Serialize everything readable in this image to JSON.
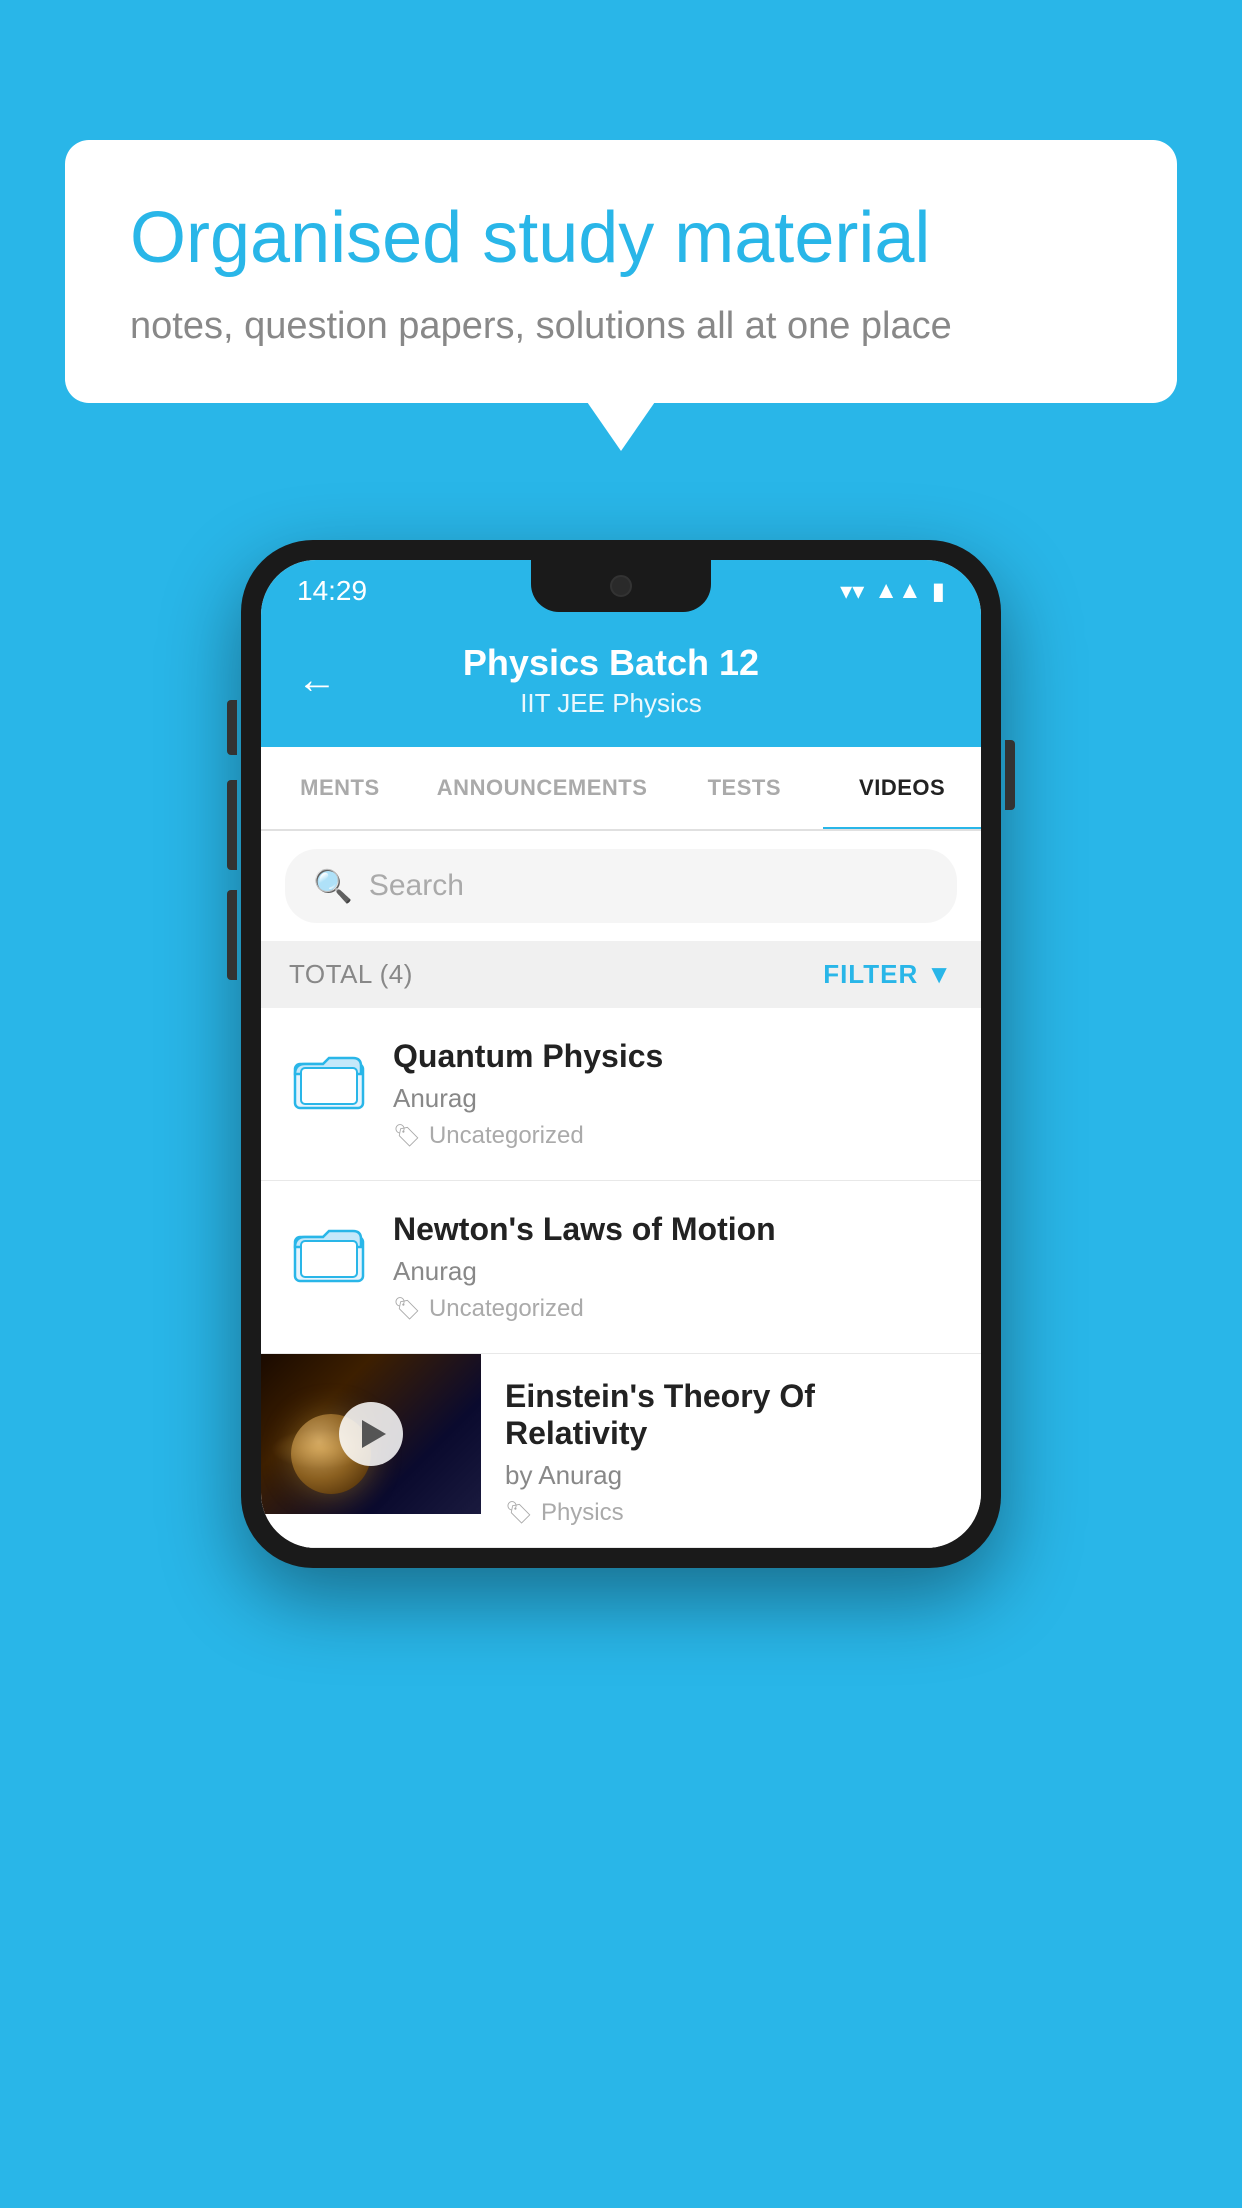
{
  "background_color": "#29b6e8",
  "speech_bubble": {
    "title": "Organised study material",
    "subtitle": "notes, question papers, solutions all at one place"
  },
  "status_bar": {
    "time": "14:29",
    "wifi": "▼",
    "signal": "◀",
    "battery": "▮"
  },
  "app_header": {
    "back_label": "←",
    "title": "Physics Batch 12",
    "subtitle": "IIT JEE   Physics"
  },
  "tabs": [
    {
      "label": "MENTS",
      "active": false
    },
    {
      "label": "ANNOUNCEMENTS",
      "active": false
    },
    {
      "label": "TESTS",
      "active": false
    },
    {
      "label": "VIDEOS",
      "active": true
    }
  ],
  "search": {
    "placeholder": "Search"
  },
  "filter_bar": {
    "total_label": "TOTAL (4)",
    "filter_label": "FILTER"
  },
  "list_items": [
    {
      "title": "Quantum Physics",
      "author": "Anurag",
      "tag": "Uncategorized",
      "type": "folder"
    },
    {
      "title": "Newton's Laws of Motion",
      "author": "Anurag",
      "tag": "Uncategorized",
      "type": "folder"
    },
    {
      "title": "Einstein's Theory Of Relativity",
      "author": "by Anurag",
      "tag": "Physics",
      "type": "video"
    }
  ]
}
